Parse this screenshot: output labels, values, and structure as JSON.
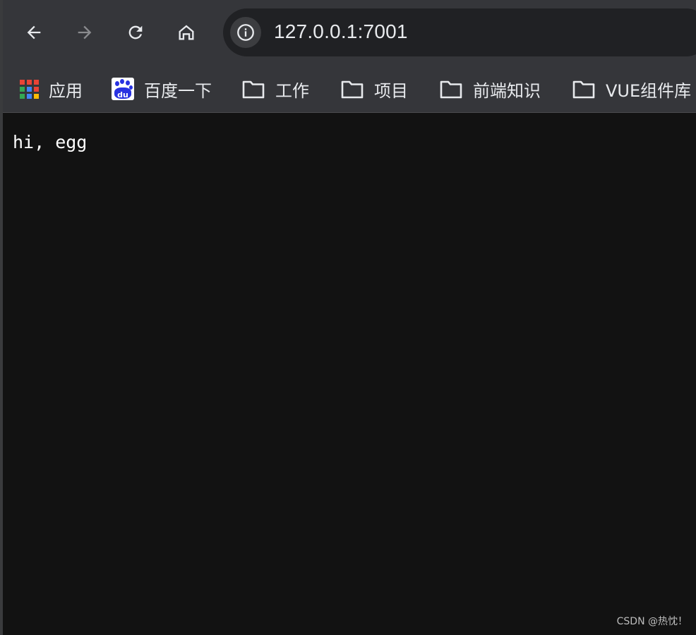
{
  "toolbar": {
    "back_icon": "arrow-left-icon",
    "forward_icon": "arrow-right-icon",
    "reload_icon": "reload-icon",
    "home_icon": "home-icon",
    "info_icon": "info-circle-icon",
    "url": "127.0.0.1:7001"
  },
  "bookmarks": {
    "items": [
      {
        "label": "应用",
        "icon": "apps-grid-icon"
      },
      {
        "label": "百度一下",
        "icon": "baidu-paw-icon",
        "icon_text": "du"
      },
      {
        "label": "工作",
        "icon": "folder-icon"
      },
      {
        "label": "项目",
        "icon": "folder-icon"
      },
      {
        "label": "前端知识",
        "icon": "folder-icon"
      },
      {
        "label": "VUE组件库",
        "icon": "folder-icon"
      }
    ]
  },
  "page": {
    "text": "hi, egg"
  },
  "watermark": "CSDN @热忱！",
  "colors": {
    "toolbar_bg": "#35363a",
    "omnibox_bg": "#202124",
    "page_bg": "#121212",
    "text": "#e8eaed"
  }
}
